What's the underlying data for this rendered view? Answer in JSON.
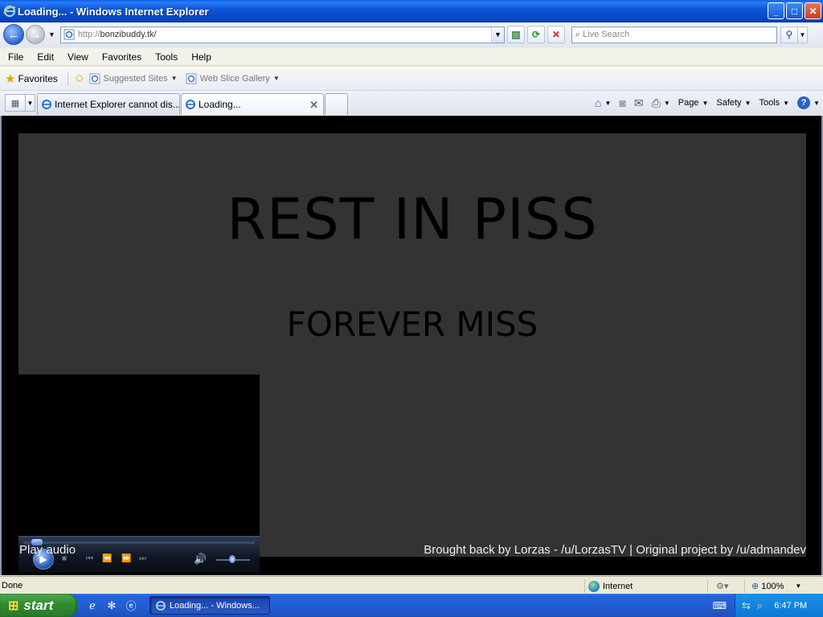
{
  "window": {
    "title": "Loading... - Windows Internet Explorer",
    "controls": {
      "minimize": "_",
      "maximize": "□",
      "close": "✕"
    }
  },
  "addressbar": {
    "url_prefix": "http://",
    "url_host": "bonzibuddy.tk/",
    "search_placeholder": "Live Search"
  },
  "menu": [
    "File",
    "Edit",
    "View",
    "Favorites",
    "Tools",
    "Help"
  ],
  "favorites": {
    "label": "Favorites",
    "items": [
      "Suggested Sites",
      "Web Slice Gallery"
    ]
  },
  "tabs": [
    {
      "label": "Internet Explorer cannot dis..."
    },
    {
      "label": "Loading..."
    }
  ],
  "commandbar": {
    "page": "Page",
    "safety": "Safety",
    "tools": "Tools"
  },
  "page": {
    "headline": "REST IN PISS",
    "subheadline": "FOREVER MISS",
    "play_audio": "Play audio",
    "credits": "Brought back by Lorzas - /u/LorzasTV | Original project by /u/admandev",
    "stage_color": "#333333"
  },
  "statusbar": {
    "status": "Done",
    "zone": "Internet",
    "zoom": "100%"
  },
  "taskbar": {
    "start_label": "start",
    "task_item": "Loading... - Windows...",
    "clock": "6:47 PM"
  },
  "colors": {
    "titlebar_blue": "#0a5fe8",
    "start_green": "#2e8a2e",
    "tray_blue": "#0f78d4"
  }
}
